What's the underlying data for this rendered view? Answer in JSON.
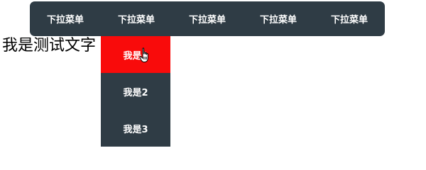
{
  "menubar": {
    "items": [
      {
        "label": "下拉菜单"
      },
      {
        "label": "下拉菜单"
      },
      {
        "label": "下拉菜单"
      },
      {
        "label": "下拉菜单"
      },
      {
        "label": "下拉菜单"
      }
    ]
  },
  "content": {
    "test_text": "我是测试文字"
  },
  "submenu": {
    "items": [
      {
        "label": "我是1",
        "active": true
      },
      {
        "label": "我是2",
        "active": false
      },
      {
        "label": "我是3",
        "active": false
      }
    ]
  },
  "colors": {
    "menu_bg": "#2f3c45",
    "active_bg": "#f90b0b",
    "menu_text": "#ffffff"
  },
  "cursor": {
    "icon": "hand-pointer-icon"
  }
}
